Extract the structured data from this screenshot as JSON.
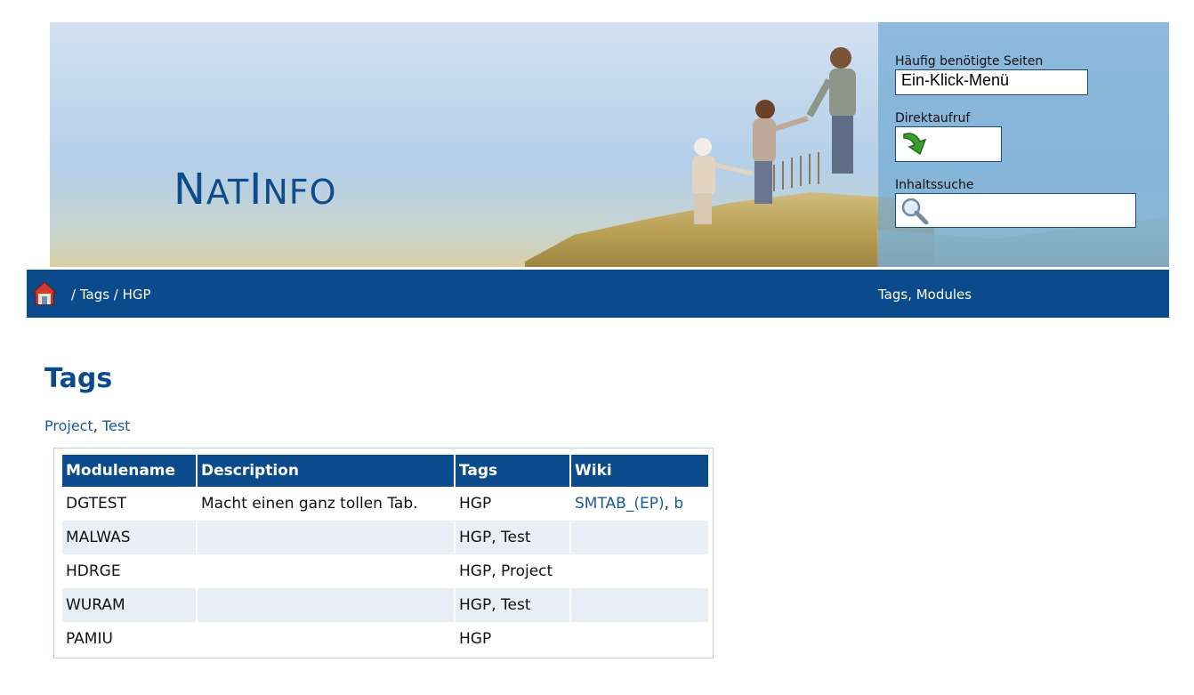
{
  "header": {
    "logo": {
      "first": "N",
      "mid": "AT",
      "second": "I",
      "rest": "NFO"
    },
    "quick_pages": {
      "label": "Häufig benötigte Seiten",
      "value": "Ein-Klick-Menü"
    },
    "direct_call": {
      "label": "Direktaufruf",
      "icon": "green-arrow-icon"
    },
    "content_search": {
      "label": "Inhaltssuche",
      "icon": "magnifier-icon"
    }
  },
  "nav": {
    "breadcrumb": "/ Tags / HGP",
    "right_links": "Tags, Modules"
  },
  "main": {
    "title": "Tags",
    "tag_links": [
      "Project",
      "Test"
    ],
    "table": {
      "headers": [
        "Modulename",
        "Description",
        "Tags",
        "Wiki"
      ],
      "rows": [
        {
          "name": "DGTEST",
          "description": "Macht einen ganz tollen Tab.",
          "tags": "HGP",
          "wiki": [
            "SMTAB_(EP)",
            "b"
          ]
        },
        {
          "name": "MALWAS",
          "description": "",
          "tags": "HGP, Test",
          "wiki": []
        },
        {
          "name": "HDRGE",
          "description": "",
          "tags": "HGP, Project",
          "wiki": []
        },
        {
          "name": "WURAM",
          "description": "",
          "tags": "HGP, Test",
          "wiki": []
        },
        {
          "name": "PAMIU",
          "description": "",
          "tags": "HGP",
          "wiki": []
        }
      ]
    }
  },
  "colors": {
    "brand_blue": "#0b4a8b",
    "link": "#1a5c97",
    "row_alt": "#e8eff6"
  }
}
